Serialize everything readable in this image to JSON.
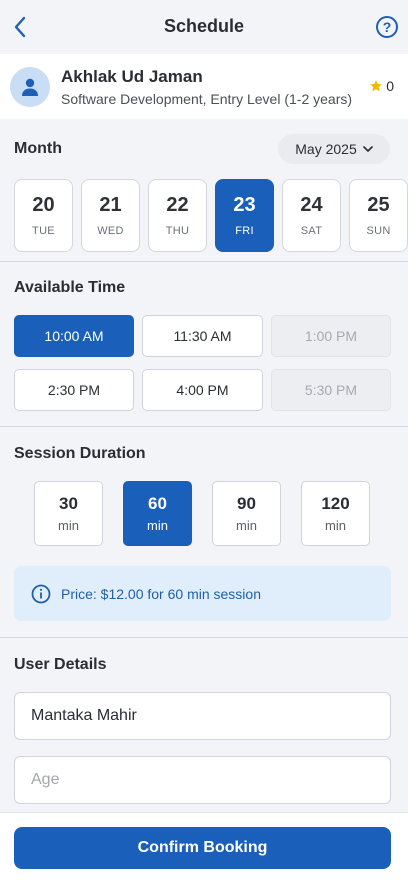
{
  "header": {
    "title": "Schedule",
    "help_label": "?"
  },
  "mentor": {
    "name": "Akhlak Ud Jaman",
    "subtitle": "Software Development, Entry Level (1-2 years)",
    "rating": "0"
  },
  "month": {
    "label": "Month",
    "selected": "May 2025"
  },
  "days": [
    {
      "num": "20",
      "dow": "TUE",
      "selected": false
    },
    {
      "num": "21",
      "dow": "WED",
      "selected": false
    },
    {
      "num": "22",
      "dow": "THU",
      "selected": false
    },
    {
      "num": "23",
      "dow": "FRI",
      "selected": true
    },
    {
      "num": "24",
      "dow": "SAT",
      "selected": false
    },
    {
      "num": "25",
      "dow": "SUN",
      "selected": false
    }
  ],
  "available_time": {
    "label": "Available Time",
    "slots": [
      {
        "label": "10:00 AM",
        "state": "selected"
      },
      {
        "label": "11:30 AM",
        "state": "available"
      },
      {
        "label": "1:00 PM",
        "state": "disabled"
      },
      {
        "label": "2:30 PM",
        "state": "available"
      },
      {
        "label": "4:00 PM",
        "state": "available"
      },
      {
        "label": "5:30 PM",
        "state": "disabled"
      }
    ]
  },
  "session_duration": {
    "label": "Session Duration",
    "options": [
      {
        "value": "30",
        "unit": "min",
        "selected": false
      },
      {
        "value": "60",
        "unit": "min",
        "selected": true
      },
      {
        "value": "90",
        "unit": "min",
        "selected": false
      },
      {
        "value": "120",
        "unit": "min",
        "selected": false
      }
    ]
  },
  "price_info": "Price: $12.00 for 60 min session",
  "user_details": {
    "label": "User Details",
    "name_value": "Mantaka Mahir",
    "age_placeholder": "Age"
  },
  "confirm_label": "Confirm Booking",
  "colors": {
    "accent": "#1a5fb9",
    "star": "#f5b800",
    "info_bg": "#e0eefb"
  }
}
